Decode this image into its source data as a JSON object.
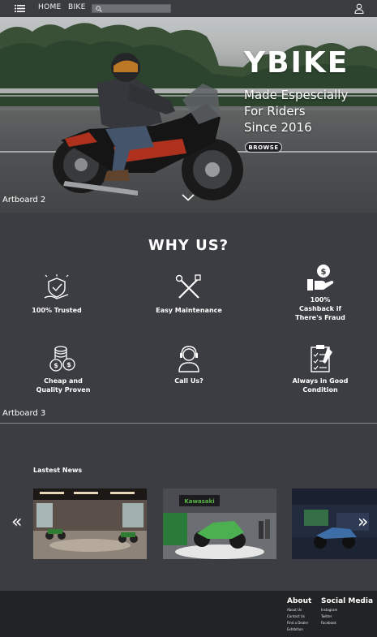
{
  "nav": {
    "home": "HOME",
    "bike": "BIKE",
    "search_placeholder": "",
    "icons": [
      "menu-icon",
      "search-icon",
      "user-icon"
    ]
  },
  "hero": {
    "brand": "YBIKE",
    "tagline_lines": [
      "Made Espescially",
      "For Riders",
      "Since 2016"
    ],
    "browse": "BROWSE"
  },
  "artboards": [
    "Artboard 2",
    "Artboard 3"
  ],
  "why_us": {
    "title": "WHY US?",
    "features": [
      {
        "label": "100% Trusted",
        "icon": "trust-shield-icon"
      },
      {
        "label": "Easy Maintenance",
        "icon": "tools-icon"
      },
      {
        "label": "100% Cashback if There's Fraud",
        "icon": "cashback-icon"
      },
      {
        "label": "Cheap and Quality Proven",
        "icon": "coins-icon"
      },
      {
        "label": "Call Us?",
        "icon": "support-agent-icon"
      },
      {
        "label": "Always in Good Condition",
        "icon": "checklist-icon"
      }
    ]
  },
  "news": {
    "title": "Lastest News",
    "prev": "«",
    "next": "»"
  },
  "footer": {
    "about": {
      "heading": "About",
      "items": [
        "About Us",
        "Contact Us",
        "Find a Dealer",
        "Exhibition"
      ]
    },
    "social": {
      "heading": "Social Media",
      "items": [
        "Instagram",
        "Twitter",
        "Facebook"
      ]
    }
  },
  "colors": {
    "topbar": "#3a3c40",
    "section": "#3b3d42",
    "footer": "#222325",
    "bike_red": "#c8361e"
  }
}
